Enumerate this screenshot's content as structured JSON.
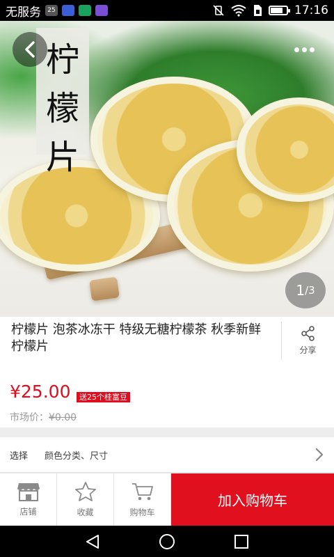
{
  "status_bar": {
    "carrier": "无服务",
    "notification_icons": [
      "calendar-25-icon",
      "uc-browser-icon",
      "shield-app-icon",
      "gallery-app-icon"
    ],
    "system_icons": [
      "mute-vibrate-icon",
      "wifi-icon",
      "sim-icon",
      "battery-icon"
    ],
    "battery_level": 0.78,
    "time": "17:16"
  },
  "hero": {
    "title_chars": [
      "柠",
      "檬",
      "片"
    ],
    "pager": "1/3",
    "pager_current": "1",
    "pager_total": "/3"
  },
  "product": {
    "title": "柠檬片 泡茶冰冻干 特级无糖柠檬茶 秋季新鲜 柠檬片",
    "share_label": "分享",
    "price": "¥25.00",
    "bonus_badge": "送25个桂富豆",
    "market_price_label": "市场价：",
    "market_price": "¥0.00"
  },
  "options": {
    "label": "选择",
    "value": "颜色分类、尺寸"
  },
  "bottom_bar": {
    "store_label": "店铺",
    "favorite_label": "收藏",
    "cart_label": "购物车",
    "add_to_cart_label": "加入购物车"
  },
  "colors": {
    "accent_red": "#e00d1e",
    "gray_text": "#999999"
  }
}
